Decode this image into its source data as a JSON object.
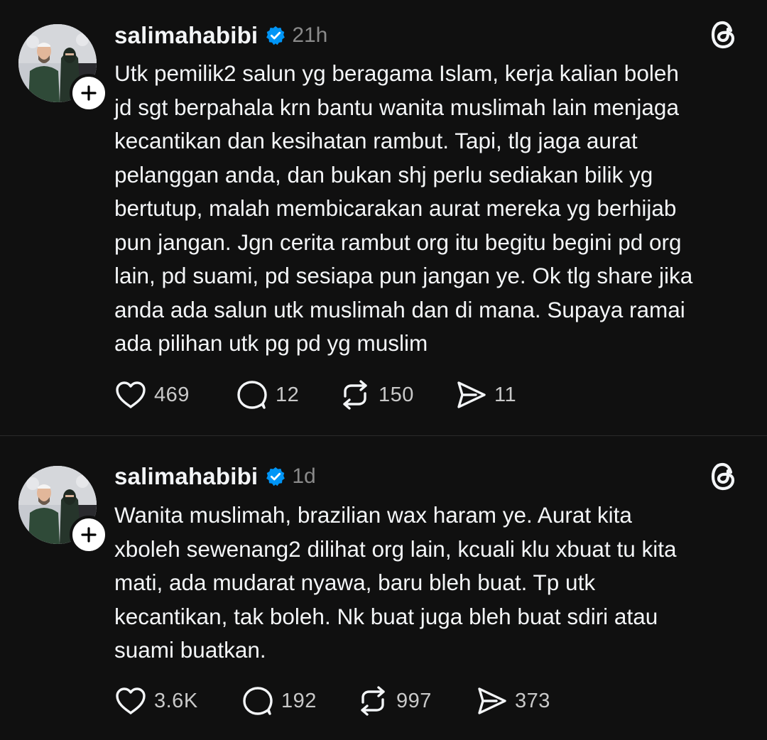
{
  "posts": [
    {
      "username": "salimahabibi",
      "time": "21h",
      "text": "Utk pemilik2 salun yg beragama Islam, kerja kalian boleh\njd sgt berpahala krn bantu wanita muslimah lain menjaga\nkecantikan dan kesihatan rambut. Tapi, tlg jaga aurat\npelanggan anda, dan bukan shj perlu sediakan bilik yg\nbertutup, malah membicarakan aurat mereka yg berhijab\npun jangan. Jgn cerita rambut org itu begitu begini pd org\nlain, pd suami, pd sesiapa pun jangan ye. Ok tlg share jika\nanda ada salun utk muslimah dan di mana. Supaya ramai\nada pilihan utk pg pd yg muslim",
      "likes": "469",
      "replies": "12",
      "reposts": "150",
      "shares": "11"
    },
    {
      "username": "salimahabibi",
      "time": "1d",
      "text": "Wanita muslimah, brazilian wax haram ye. Aurat kita\nxboleh sewenang2 dilihat org lain, kcuali klu xbuat tu kita\nmati, ada mudarat nyawa, baru bleh buat. Tp utk\nkecantikan, tak boleh. Nk buat juga bleh buat sdiri atau\nsuami buatkan.",
      "likes": "3.6K",
      "replies": "192",
      "reposts": "997",
      "shares": "373"
    }
  ],
  "icons": {
    "verified": "verified-badge-icon",
    "follow": "plus-icon",
    "like": "heart-icon",
    "reply": "comment-bubble-icon",
    "repost": "repost-arrows-icon",
    "share": "send-icon",
    "app": "threads-logo-icon"
  },
  "colors": {
    "background": "#101010",
    "text": "#f3f5f7",
    "muted": "#8a8a8a",
    "verified": "#0095f6"
  }
}
